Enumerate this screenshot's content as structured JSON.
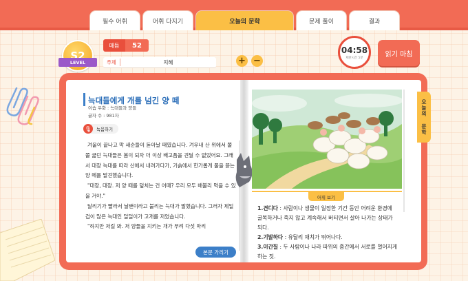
{
  "tabs": [
    {
      "label": "필수 어휘"
    },
    {
      "label": "어휘 다지기"
    },
    {
      "label": "오늘의 문학"
    },
    {
      "label": "문제 풀이"
    },
    {
      "label": "결과"
    }
  ],
  "level": {
    "badge": "S2",
    "ribbon": "LEVEL"
  },
  "info": {
    "count_label": "매듭",
    "count_value": "52",
    "topic_label": "주제",
    "topic_value": "지혜"
  },
  "zoom": {
    "in": "+",
    "out": "−"
  },
  "timer": {
    "time": "04:58",
    "sub": "제한시간 5분"
  },
  "finish_label": "읽기 마침",
  "side_tab": "오늘의 문학",
  "story": {
    "title": "늑대들에게 개를 넘긴 양 떼",
    "author": "이솝 우화 : 늑대들과 양들",
    "chars": "글자 수 : 981자",
    "record_label": "녹음하기",
    "paragraphs": [
      "겨울이 끝나고 막 새순들이 돋아날 때였습니다. 겨우내 산 위에서 쫄쫄 굶던 늑대들은 봄이 되자 더 이상 배고픔을 견딜 수 없었어요. 그래서 대장 늑대를 따라 산에서 내려가다가, 기슭에서 한가롭게 풀을 뜯는 양 떼를 발견했습니다.",
      "\"대장, 대장. 저 양 떼를 덮치는 건 어때? 우리 모두 배불리 먹을 수 있을 거야.\"",
      "달리기가 빨라서 날쌘이라고 불리는 늑대가 말했습니다. 그러자 제일 겁이 많은 늑대인 덜덜이가 고개를 저었습니다.",
      "\"하지만 저길 봐. 저 양들을 지키는 개가 무려 다섯 마리"
    ],
    "hide_label": "본문 가리기"
  },
  "vocab": {
    "title": "어휘 보기",
    "items": [
      {
        "num": "1.",
        "word": "견디다",
        "def": " : 사람이나 생물이 일정한 기간 동안 어려운 환경에 굴복하거나 죽지 않고 계속해서 버티면서 살아 나가는 상태가 되다."
      },
      {
        "num": "2.",
        "word": "기발하다",
        "def": " : 유달리 재치가 뛰어나다."
      },
      {
        "num": "3.",
        "word": "이간질",
        "def": " : 두 사람이나 나라 따위의 중간에서 서로를 멀어지게 하는 짓."
      }
    ]
  },
  "colors": {
    "accent": "#f26b55",
    "yellow": "#fbbf45",
    "blue": "#3c7fc8",
    "purple": "#9b59c9"
  }
}
